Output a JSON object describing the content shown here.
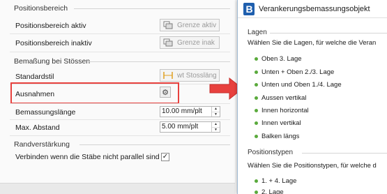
{
  "left_panel": {
    "positionsbereich": {
      "title": "Positionsbereich",
      "aktiv_label": "Positionsbereich aktiv",
      "aktiv_value": "Grenze aktiv",
      "inaktiv_label": "Positionsbereich inaktiv",
      "inaktiv_value": "Grenze inak"
    },
    "bemassung": {
      "title": "Bemaßung bei Stössen",
      "standardstil_label": "Standardstil",
      "standardstil_value": "wt Stossläng",
      "ausnahmen_label": "Ausnahmen",
      "ausnahmen_icon": "gear-icon",
      "laenge_label": "Bemassungslänge",
      "laenge_value": "10.00 mm/plt",
      "abstand_label": "Max. Abstand",
      "abstand_value": "5.00 mm/plt"
    },
    "rand": {
      "title": "Randverstärkung",
      "verbinden_label": "Verbinden wenn die Stäbe nicht parallel sind",
      "verbinden_checked": "✓"
    }
  },
  "highlight_color": "#e8413e",
  "dialog": {
    "title": "Verankerungsbemassungsobjekt",
    "logo_letter": "B",
    "lagen": {
      "title": "Lagen",
      "description": "Wählen Sie die Lagen, für welche die Veran",
      "items": [
        "Oben 3. Lage",
        "Unten + Oben 2./3. Lage",
        "Unten und Oben 1./4. Lage",
        "Aussen vertikal",
        "Innen horizontal",
        "Innen vertikal",
        "Balken längs"
      ]
    },
    "positionstypen": {
      "title": "Positionstypen",
      "description": "Wählen Sie die Positionstypen, für welche d",
      "items": [
        "1. + 4. Lage",
        "2. Lage"
      ]
    },
    "item_dot_color": "#5aaa3c"
  }
}
